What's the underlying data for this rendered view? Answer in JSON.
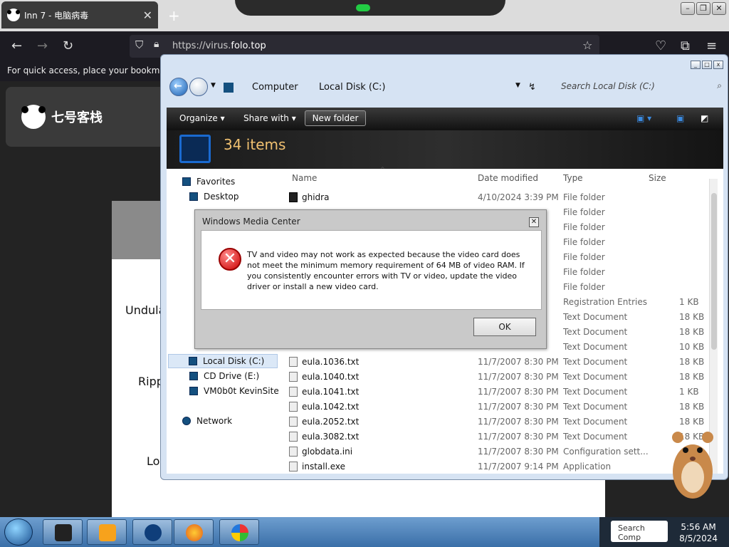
{
  "browser": {
    "tab_title": "Inn 7 - 电脑病毒",
    "tab_close": "✕",
    "new_tab": "+",
    "url_prefix": "https://virus.",
    "url_domain": "folo.top",
    "bookmarks_hint": "For quick access, place your bookmarks h",
    "window_buttons": [
      "–",
      "❐",
      "✕"
    ]
  },
  "page": {
    "site_name": "七号客栈",
    "texts": [
      "Undula",
      "Ripp",
      "Lo"
    ]
  },
  "explorer": {
    "breadcrumbs": [
      "Computer",
      "Local Disk (C:)"
    ],
    "search_placeholder": "Search Local Disk (C:)",
    "toolbar": {
      "organize": "Organize",
      "share_with": "Share with",
      "new_folder": "New folder"
    },
    "item_count": "34 items",
    "nav": {
      "favorites": "Favorites",
      "desktop": "Desktop",
      "local_disk": "Local Disk (C:)",
      "cd_drive": "CD Drive (E:)",
      "vm_site": "VM0b0t KevinSite",
      "network": "Network"
    },
    "columns": {
      "name": "Name",
      "date": "Date modified",
      "type": "Type",
      "size": "Size"
    },
    "rows": [
      {
        "name": "ghidra",
        "date": "4/10/2024 3:39 PM",
        "type": "File folder",
        "size": ""
      },
      {
        "name": "",
        "date": "",
        "type": "File folder",
        "size": ""
      },
      {
        "name": "",
        "date": "",
        "type": "File folder",
        "size": ""
      },
      {
        "name": "",
        "date": "",
        "type": "File folder",
        "size": ""
      },
      {
        "name": "",
        "date": "",
        "type": "File folder",
        "size": ""
      },
      {
        "name": "",
        "date": "",
        "type": "File folder",
        "size": ""
      },
      {
        "name": "",
        "date": "",
        "type": "File folder",
        "size": ""
      },
      {
        "name": "",
        "date": "",
        "type": "Registration Entries",
        "size": "1 KB"
      },
      {
        "name": "",
        "date": "",
        "type": "Text Document",
        "size": "18 KB"
      },
      {
        "name": "",
        "date": "",
        "type": "Text Document",
        "size": "18 KB"
      },
      {
        "name": "",
        "date": "",
        "type": "Text Document",
        "size": "10 KB"
      },
      {
        "name": "eula.1036.txt",
        "date": "11/7/2007 8:30 PM",
        "type": "Text Document",
        "size": "18 KB"
      },
      {
        "name": "eula.1040.txt",
        "date": "11/7/2007 8:30 PM",
        "type": "Text Document",
        "size": "18 KB"
      },
      {
        "name": "eula.1041.txt",
        "date": "11/7/2007 8:30 PM",
        "type": "Text Document",
        "size": "1 KB"
      },
      {
        "name": "eula.1042.txt",
        "date": "11/7/2007 8:30 PM",
        "type": "Text Document",
        "size": "18 KB"
      },
      {
        "name": "eula.2052.txt",
        "date": "11/7/2007 8:30 PM",
        "type": "Text Document",
        "size": "18 KB"
      },
      {
        "name": "eula.3082.txt",
        "date": "11/7/2007 8:30 PM",
        "type": "Text Document",
        "size": "18 KB"
      },
      {
        "name": "globdata.ini",
        "date": "11/7/2007 8:30 PM",
        "type": "Configuration sett...",
        "size": ""
      },
      {
        "name": "install.exe",
        "date": "11/7/2007 9:14 PM",
        "type": "Application",
        "size": ""
      }
    ]
  },
  "dialog": {
    "title": "Windows Media Center",
    "message": "TV and video may not work as expected because the video card does not meet the minimum memory requirement of 64 MB of video RAM. If you consistently encounter errors with TV or video, update the video driver or install a new video card.",
    "ok": "OK",
    "close": "✕"
  },
  "taskbar": {
    "time": "5:56 AM",
    "date": "8/5/2024",
    "search_text": "Search Comp"
  }
}
